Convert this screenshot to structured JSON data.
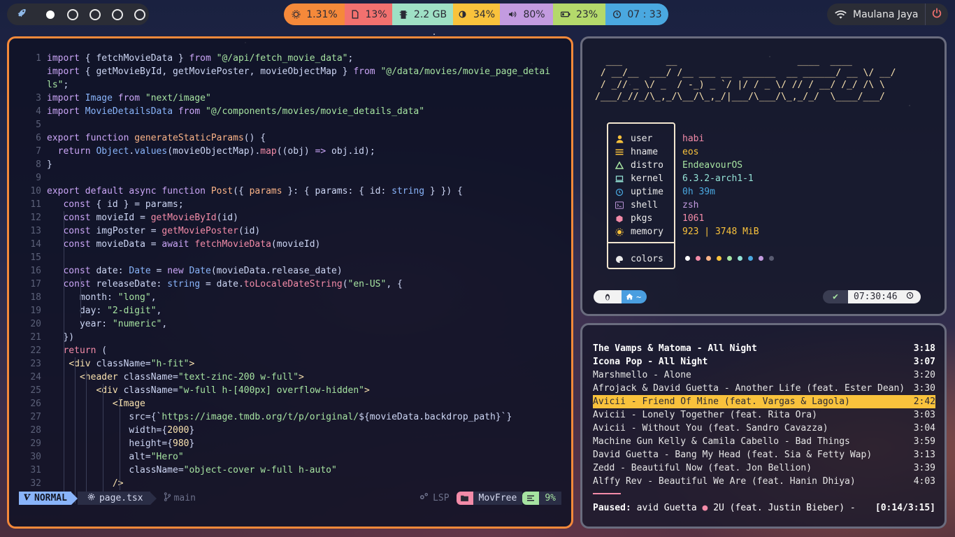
{
  "topbar": {
    "workspaces": [
      "1",
      "2",
      "3",
      "4",
      "5"
    ],
    "active_workspace": 0,
    "modules": [
      {
        "name": "cpu",
        "icon": "cpu-icon",
        "value": "1.31%",
        "color": "#f5893a"
      },
      {
        "name": "disk",
        "icon": "sd-card-icon",
        "value": "13%",
        "color": "#f2716f"
      },
      {
        "name": "memory",
        "icon": "memory-chip-icon",
        "value": "2.2 GB",
        "color": "#9fe0c5"
      },
      {
        "name": "brightness",
        "icon": "brightness-icon",
        "value": "34%",
        "color": "#f9c23c"
      },
      {
        "name": "volume",
        "icon": "speaker-icon",
        "value": "80%",
        "color": "#c39be0"
      },
      {
        "name": "battery",
        "icon": "battery-icon",
        "value": "23%",
        "color": "#b4d96b"
      },
      {
        "name": "clock",
        "icon": "clock-icon",
        "value": "07 : 33",
        "color": "#4aa8e0"
      }
    ],
    "network_name": "Maulana Jaya"
  },
  "editor": {
    "lines": [
      {
        "n": "1",
        "html": "<span class='k'>import</span> { fetchMovieData } <span class='k'>from</span> <span class='s'>\"@/api/fetch_movie_data\"</span>;"
      },
      {
        "n": "",
        "html": "<span class='k'>import</span> { getMovieById, getMoviePoster, movieObjectMap } <span class='k'>from</span> <span class='s'>\"@/data/movies/movie_page_detai</span>"
      },
      {
        "n": "",
        "html": "<span class='s'>ls\"</span>;"
      },
      {
        "n": "3",
        "html": "<span class='k'>import</span> <span class='t'>Image</span> <span class='k'>from</span> <span class='s'>\"next/image\"</span>"
      },
      {
        "n": "4",
        "html": "<span class='k'>import</span> <span class='t'>MovieDetailsData</span> <span class='k'>from</span> <span class='s'>\"@/components/movies/movie_details_data\"</span>"
      },
      {
        "n": "5",
        "html": ""
      },
      {
        "n": "6",
        "html": "<span class='k'>export</span> <span class='k'>function</span> <span class='n'>generateStaticParams</span>() {"
      },
      {
        "n": "7",
        "html": "  <span class='k'>return</span> <span class='t'>Object</span>.<span class='t'>values</span>(movieObjectMap).<span class='f'>map</span>((obj) <span class='k'>=></span> obj.id);"
      },
      {
        "n": "8",
        "html": "}"
      },
      {
        "n": "9",
        "html": ""
      },
      {
        "n": "10",
        "html": "<span class='k'>export default async function</span> <span class='n'>Post</span>({ <span class='n'>params</span> }: { params: { id: <span class='t'>string</span> } }) {"
      },
      {
        "n": "11",
        "html": "   <span class='k'>const</span> { id } = params;"
      },
      {
        "n": "12",
        "html": "   <span class='k'>const</span> movieId = <span class='f'>getMovieById</span>(id)"
      },
      {
        "n": "13",
        "html": "   <span class='k'>const</span> imgPoster = <span class='f'>getMoviePoster</span>(id)"
      },
      {
        "n": "14",
        "html": "   <span class='k'>const</span> movieData = <span class='k'>await</span> <span class='f'>fetchMovieData</span>(movieId)"
      },
      {
        "n": "15",
        "html": ""
      },
      {
        "n": "16",
        "html": "   <span class='k'>const</span> date: <span class='t'>Date</span> = <span class='k'>new</span> <span class='t'>Date</span>(movieData.release_date)"
      },
      {
        "n": "17",
        "html": "   <span class='k'>const</span> releaseDate: <span class='t'>string</span> = date.<span class='f'>toLocaleDateString</span>(<span class='s'>\"en-US\"</span>, {"
      },
      {
        "n": "18",
        "html": "      month: <span class='s'>\"long\"</span>,"
      },
      {
        "n": "19",
        "html": "      day: <span class='s'>\"2-digit\"</span>,"
      },
      {
        "n": "20",
        "html": "      year: <span class='s'>\"numeric\"</span>,"
      },
      {
        "n": "21",
        "html": "   })"
      },
      {
        "n": "22",
        "html": "   <span class='kr'>return</span> ("
      },
      {
        "n": "23",
        "html": "    <span class='tag'>&lt;div</span> className=<span class='s'>\"h-fit\"</span><span class='tag'>&gt;</span>"
      },
      {
        "n": "24",
        "html": "      <span class='tag'>&lt;header</span> className=<span class='s'>\"text-zinc-200 w-full\"</span><span class='tag'>&gt;</span>"
      },
      {
        "n": "25",
        "html": "         <span class='tag'>&lt;div</span> className=<span class='s'>\"w-full h-[400px] overflow-hidden\"</span><span class='tag'>&gt;</span>"
      },
      {
        "n": "26",
        "html": "            <span class='tag'>&lt;Image</span>"
      },
      {
        "n": "27",
        "html": "               src={`<span class='s'>https://image.tmdb.org/t/p/original/</span>${movieData.backdrop_path}`}"
      },
      {
        "n": "28",
        "html": "               width={<span class='tag'>2000</span>}"
      },
      {
        "n": "29",
        "html": "               height={<span class='tag'>980</span>}"
      },
      {
        "n": "30",
        "html": "               alt=<span class='s'>\"Hero\"</span>"
      },
      {
        "n": "31",
        "html": "               className=<span class='s'>\"object-cover w-full h-auto\"</span>"
      },
      {
        "n": "32",
        "html": "            <span class='tag'>/&gt;</span>"
      }
    ],
    "status": {
      "mode": "NORMAL",
      "file": "page.tsx",
      "branch": "main",
      "lsp": "LSP",
      "project": "MovFree",
      "percent": "9%"
    }
  },
  "fetch": {
    "ascii": "  ___        __                      ____  ____\n / __/__  ___/ /__ ___ __  ______  __ ______/ __ \\/ __/\n / _// _ \\/ _  / -_) _ `/ |/ / _ \\/ // / __/ /_/ /\\ \\\n/___/_//_/\\_,_/\\__/\\_,_/|___/\\___/\\_,_/_/  \\____/___/",
    "rows": [
      {
        "label": "user",
        "value": "habi",
        "icon": "user-icon",
        "icolor": "#f9c23c",
        "vcolor": "#f38ba8"
      },
      {
        "label": "hname",
        "value": "eos",
        "icon": "hostname-icon",
        "icolor": "#f9c23c",
        "vcolor": "#f9c23c"
      },
      {
        "label": "distro",
        "value": "EndeavourOS",
        "icon": "distro-icon",
        "icolor": "#a6e3a1",
        "vcolor": "#a6e3a1"
      },
      {
        "label": "kernel",
        "value": "6.3.2-arch1-1",
        "icon": "kernel-icon",
        "icolor": "#94e2d5",
        "vcolor": "#94e2d5"
      },
      {
        "label": "uptime",
        "value": "0h 39m",
        "icon": "uptime-icon",
        "icolor": "#4aa8e0",
        "vcolor": "#4aa8e0"
      },
      {
        "label": "shell",
        "value": "zsh",
        "icon": "shell-icon",
        "icolor": "#c39be0",
        "vcolor": "#c39be0"
      },
      {
        "label": "pkgs",
        "value": "1061",
        "icon": "package-icon",
        "icolor": "#f38ba8",
        "vcolor": "#f38ba8"
      },
      {
        "label": "memory",
        "value": "923 | 3748 MiB",
        "icon": "memory-icon",
        "icolor": "#f9c23c",
        "vcolor": "#f9c23c"
      }
    ],
    "colors_label": "colors",
    "palette": [
      "#ffffff",
      "#f38ba8",
      "#fab387",
      "#f9c23c",
      "#a6e3a1",
      "#94e2d5",
      "#4aa8e0",
      "#c39be0",
      "#585b70"
    ],
    "prompt_left_dir": "~",
    "prompt_time": "07:30:46"
  },
  "music": {
    "tracks": [
      {
        "title": "The Vamps & Matoma - All Night",
        "dur": "3:18",
        "style": "bold"
      },
      {
        "title": "Icona Pop - All Night",
        "dur": "3:07",
        "style": "bold"
      },
      {
        "title": "Marshmello - Alone",
        "dur": "3:20",
        "style": ""
      },
      {
        "title": "Afrojack & David Guetta - Another Life (feat. Ester Dean)",
        "dur": "3:30",
        "style": ""
      },
      {
        "title": "Avicii - Friend Of Mine (feat. Vargas & Lagola)",
        "dur": "2:42",
        "style": "sel"
      },
      {
        "title": "Avicii - Lonely Together (feat. Rita Ora)",
        "dur": "3:03",
        "style": ""
      },
      {
        "title": "Avicii - Without You (feat. Sandro Cavazza)",
        "dur": "3:04",
        "style": ""
      },
      {
        "title": "Machine Gun Kelly & Camila Cabello - Bad Things",
        "dur": "3:59",
        "style": ""
      },
      {
        "title": "David Guetta - Bang My Head (feat. Sia & Fetty Wap)",
        "dur": "3:13",
        "style": ""
      },
      {
        "title": "Zedd - Beautiful Now (feat. Jon Bellion)",
        "dur": "3:39",
        "style": ""
      },
      {
        "title": "Alffy Rev - Beautiful We Are (feat. Hanin Dhiya)",
        "dur": "4:03",
        "style": ""
      }
    ],
    "now_playing": {
      "prefix": "Paused: ",
      "text_a": "avid Guetta ",
      "dot": "●",
      "text_b": " 2U (feat. Justin Bieber) - ",
      "progress": "[0:14/3:15]"
    }
  }
}
